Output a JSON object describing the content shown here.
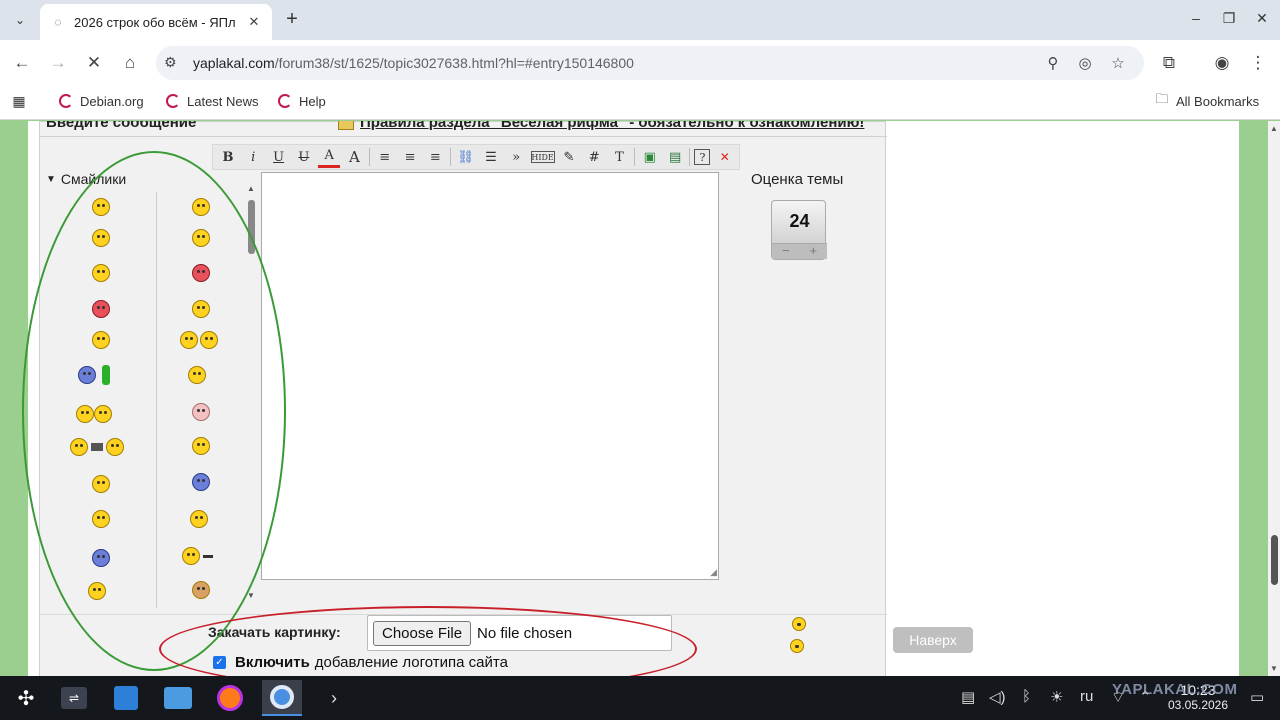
{
  "browser": {
    "tab_title": "2026 строк обо всём - ЯПл",
    "url_host": "yaplakal.com",
    "url_path": "/forum38/st/1625/topic3027638.html?hl=#entry150146800",
    "bookmarks": [
      "Debian.org",
      "Latest News",
      "Help"
    ],
    "all_bookmarks": "All Bookmarks"
  },
  "form": {
    "header_title": "Введите сообщение",
    "header_rules": "Правила раздела \"Весёлая рифма\" - обязательно к ознакомлению!",
    "smiles_label": "Смайлики",
    "toolbar_buttons": [
      "B",
      "i",
      "U",
      "U",
      "A",
      "A",
      "≡",
      "≡",
      "≡",
      "⛓",
      "☰",
      "»",
      "HIDE",
      "✎",
      "#",
      "T",
      "▣",
      "▤",
      "?",
      "✕"
    ],
    "rating_label": "Оценка темы",
    "rating_value": "24",
    "rating_minus": "−",
    "rating_plus": "+",
    "upload_label": "Закачать картинку:",
    "file_button": "Choose File",
    "file_status": "No file chosen",
    "checkbox_bold": "Включить",
    "checkbox_text": "добавление логотипа сайта"
  },
  "page": {
    "to_top": "Наверх"
  },
  "taskbar": {
    "lang": "ru",
    "time": "10:23",
    "date": "03.05.2026",
    "watermark": "YAPLAKAL.COM"
  }
}
